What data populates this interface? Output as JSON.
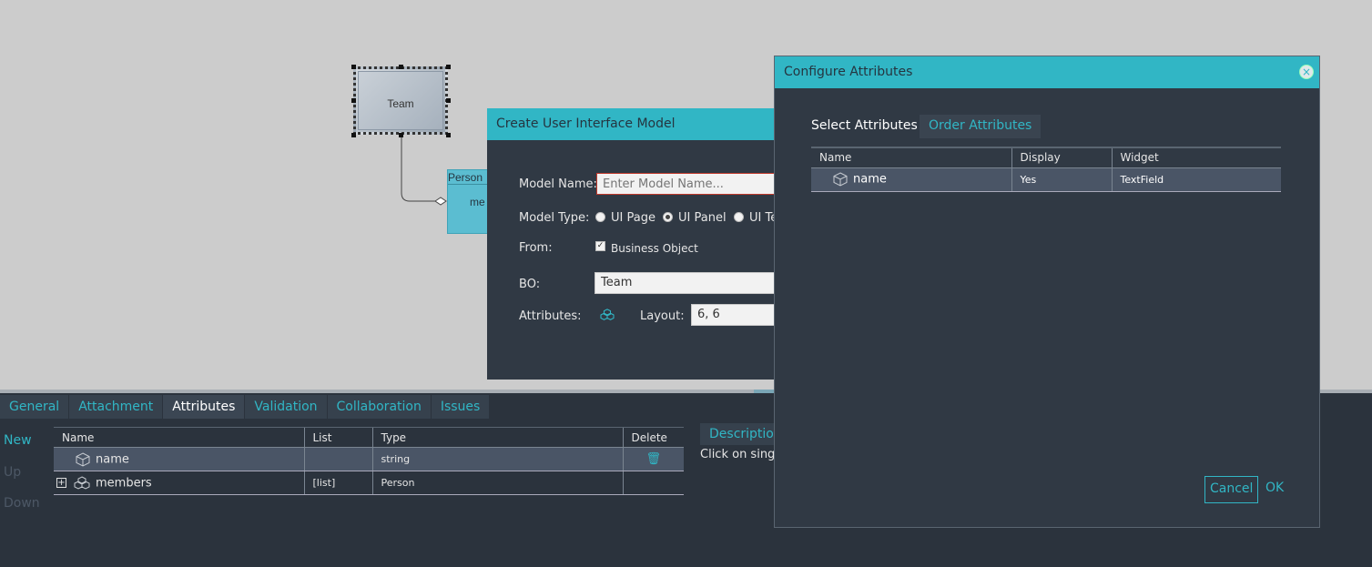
{
  "canvas": {
    "team_label": "Team",
    "person_header": "Person",
    "person_member": "me"
  },
  "create_dialog": {
    "title": "Create User Interface Model",
    "model_name_label": "Model Name:",
    "model_name_placeholder": "Enter Model Name...",
    "model_type_label": "Model Type:",
    "model_types": [
      {
        "label": "UI Page",
        "selected": false
      },
      {
        "label": "UI Panel",
        "selected": true
      },
      {
        "label": "UI Te",
        "selected": false
      }
    ],
    "from_label": "From:",
    "from_option": "Business Object",
    "from_checked": true,
    "bo_label": "BO:",
    "bo_value": "Team",
    "attributes_label": "Attributes:",
    "attributes_icon": "cubes-icon",
    "layout_label": "Layout:",
    "layout_value": "6, 6"
  },
  "config_dialog": {
    "title": "Configure Attributes",
    "tabs": {
      "select": "Select Attributes",
      "order": "Order Attributes"
    },
    "columns": [
      "Name",
      "Display",
      "Widget"
    ],
    "rows": [
      {
        "name": "name",
        "display": "Yes",
        "widget": "TextField",
        "icon": "cube-icon"
      }
    ],
    "cancel_label": "Cancel",
    "ok_label": "OK"
  },
  "bottom_panel": {
    "tabs": [
      {
        "label": "General",
        "active": false
      },
      {
        "label": "Attachment",
        "active": false
      },
      {
        "label": "Attributes",
        "active": true
      },
      {
        "label": "Validation",
        "active": false
      },
      {
        "label": "Collaboration",
        "active": false
      },
      {
        "label": "Issues",
        "active": false
      }
    ],
    "actions": {
      "new": "New",
      "up": "Up",
      "down": "Down"
    },
    "columns": [
      "Name",
      "List",
      "Type",
      "Delete"
    ],
    "rows": [
      {
        "name": "name",
        "list": "",
        "type": "string",
        "icon": "cube-icon",
        "selected": true
      },
      {
        "name": "members",
        "list": "[list]",
        "type": "Person",
        "icon": "cubes-icon",
        "selected": false
      }
    ],
    "description_tab": "Descriptio",
    "description_text": "Click on single"
  },
  "colors": {
    "accent": "#31b6c5",
    "panel": "#303944",
    "canvas": "#cccccc"
  }
}
